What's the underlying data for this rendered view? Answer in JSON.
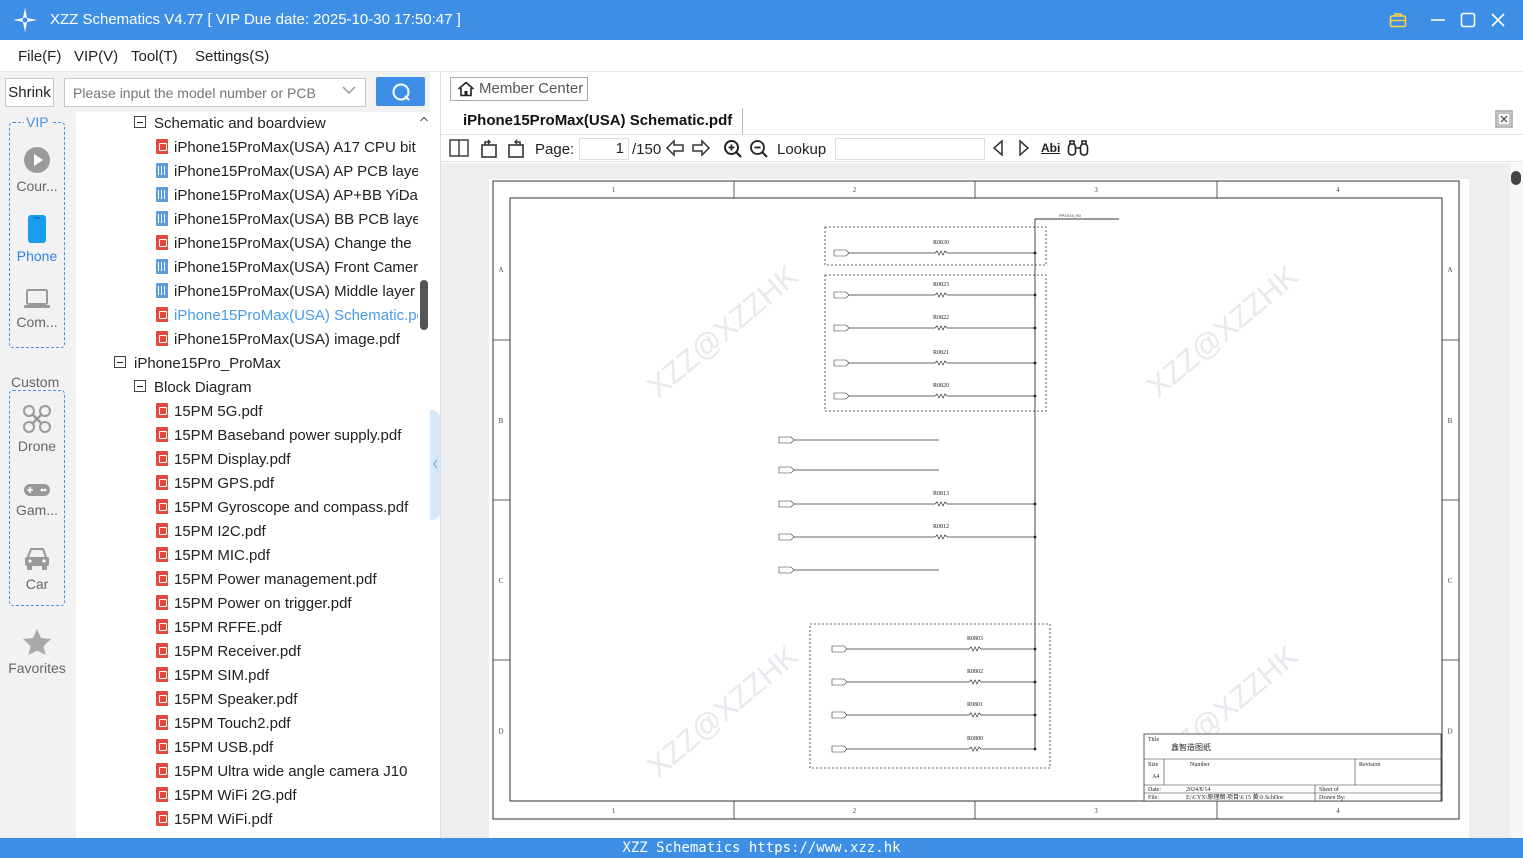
{
  "window": {
    "title": "XZZ Schematics V4.77 [ VIP Due date: 2025-10-30 17:50:47 ]"
  },
  "menu": [
    "File(F)",
    "VIP(V)",
    "Tool(T)",
    "Settings(S)"
  ],
  "search": {
    "shrink_label": "Shrink",
    "placeholder": "Please input the model number or PCB"
  },
  "categories": {
    "vip_title": "VIP",
    "custom_title": "Custom",
    "vip_items": [
      {
        "label": "Cour...",
        "icon": "play-circle-icon"
      },
      {
        "label": "Phone",
        "icon": "phone-icon",
        "selected": true
      },
      {
        "label": "Com...",
        "icon": "laptop-icon"
      }
    ],
    "custom_items": [
      {
        "label": "Drone",
        "icon": "drone-icon"
      },
      {
        "label": "Gam...",
        "icon": "gamepad-icon"
      },
      {
        "label": "Car",
        "icon": "car-icon"
      }
    ],
    "favorites": {
      "label": "Favorites",
      "icon": "star-icon"
    }
  },
  "tree": [
    {
      "level": 1,
      "type": "folder",
      "label": "Schematic and boardview"
    },
    {
      "level": 2,
      "type": "pdf",
      "label": "iPhone15ProMax(USA) A17 CPU bit"
    },
    {
      "level": 2,
      "type": "pcb",
      "label": "iPhone15ProMax(USA) AP PCB layer"
    },
    {
      "level": 2,
      "type": "pcb",
      "label": "iPhone15ProMax(USA) AP+BB YiDa"
    },
    {
      "level": 2,
      "type": "pcb",
      "label": "iPhone15ProMax(USA) BB PCB layer"
    },
    {
      "level": 2,
      "type": "pdf",
      "label": "iPhone15ProMax(USA) Change the"
    },
    {
      "level": 2,
      "type": "pcb",
      "label": "iPhone15ProMax(USA) Front Camera"
    },
    {
      "level": 2,
      "type": "pcb",
      "label": "iPhone15ProMax(USA) Middle layer"
    },
    {
      "level": 2,
      "type": "pdf",
      "label": "iPhone15ProMax(USA) Schematic.pdf",
      "selected": true
    },
    {
      "level": 2,
      "type": "pdf",
      "label": "iPhone15ProMax(USA) image.pdf"
    },
    {
      "level": 0,
      "type": "folder",
      "label": "iPhone15Pro_ProMax"
    },
    {
      "level": 1,
      "type": "folder",
      "label": "Block Diagram"
    },
    {
      "level": 2,
      "type": "pdf",
      "label": "15PM 5G.pdf"
    },
    {
      "level": 2,
      "type": "pdf",
      "label": "15PM Baseband power supply.pdf"
    },
    {
      "level": 2,
      "type": "pdf",
      "label": "15PM Display.pdf"
    },
    {
      "level": 2,
      "type": "pdf",
      "label": "15PM GPS.pdf"
    },
    {
      "level": 2,
      "type": "pdf",
      "label": "15PM Gyroscope and compass.pdf"
    },
    {
      "level": 2,
      "type": "pdf",
      "label": "15PM I2C.pdf"
    },
    {
      "level": 2,
      "type": "pdf",
      "label": "15PM MIC.pdf"
    },
    {
      "level": 2,
      "type": "pdf",
      "label": "15PM Power management.pdf"
    },
    {
      "level": 2,
      "type": "pdf",
      "label": "15PM Power on trigger.pdf"
    },
    {
      "level": 2,
      "type": "pdf",
      "label": "15PM RFFE.pdf"
    },
    {
      "level": 2,
      "type": "pdf",
      "label": "15PM Receiver.pdf"
    },
    {
      "level": 2,
      "type": "pdf",
      "label": "15PM SIM.pdf"
    },
    {
      "level": 2,
      "type": "pdf",
      "label": "15PM Speaker.pdf"
    },
    {
      "level": 2,
      "type": "pdf",
      "label": "15PM Touch2.pdf"
    },
    {
      "level": 2,
      "type": "pdf",
      "label": "15PM USB.pdf"
    },
    {
      "level": 2,
      "type": "pdf",
      "label": "15PM Ultra wide angle camera J10"
    },
    {
      "level": 2,
      "type": "pdf",
      "label": "15PM WiFi 2G.pdf"
    },
    {
      "level": 2,
      "type": "pdf",
      "label": "15PM WiFi.pdf"
    }
  ],
  "viewer": {
    "member_center": "Member Center",
    "tab_title": "iPhone15ProMax(USA) Schematic.pdf",
    "page_label": "Page:",
    "page_current": "1",
    "page_total": "/150",
    "lookup_label": "Lookup",
    "lookup_value": "",
    "abi_label": "Abi"
  },
  "schematic": {
    "cols": [
      "1",
      "2",
      "3",
      "4"
    ],
    "rows": [
      "A",
      "B",
      "C",
      "D"
    ],
    "watermark": "XZZ@XZZHK",
    "net_top": "PP1V24_S0",
    "resistors": [
      "R0830",
      "R0823",
      "R0822",
      "R0821",
      "R0820",
      "R0813",
      "R0812",
      "R0803",
      "R0802",
      "R0801",
      "R0800"
    ],
    "title_block": {
      "title_label": "Title",
      "title_value": "鑫智造图纸",
      "size_label": "Size",
      "size_value": "A4",
      "number_label": "Number",
      "revision_label": "Revision",
      "date_label": "Date:",
      "date_value": "2024/8/14",
      "file_label": "File:",
      "file_value": "E:\\CYX\\原理图\\项目\\6 15 黄\\0.SchDoc",
      "sheet_label": "Sheet   of",
      "drawn_label": "Drawn By:"
    }
  },
  "status": {
    "text": "XZZ Schematics https://www.xzz.hk"
  }
}
